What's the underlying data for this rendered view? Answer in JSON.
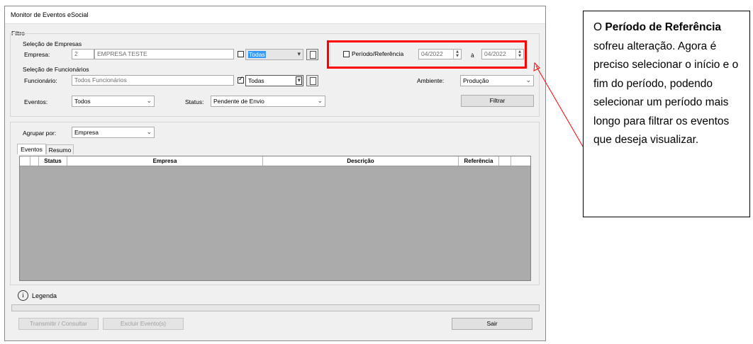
{
  "window": {
    "title": "Monitor de Eventos eSocial"
  },
  "filtro": {
    "group_label": "Filtro",
    "empresas": {
      "section_label": "Seleção de Empresas",
      "empresa_label": "Empresa:",
      "empresa_code": "2",
      "empresa_name": "EMPRESA TESTE",
      "todas_checked": false,
      "todas_value": "Todas"
    },
    "funcionarios": {
      "section_label": "Seleção de Funcionários",
      "funcionario_label": "Funcionário:",
      "funcionario_value": "Todos Funcionários",
      "todas_checked": true,
      "todas_value": "Todas"
    },
    "periodo": {
      "checkbox_label": "Período/Referência",
      "checked": false,
      "inicio": "04/2022",
      "separator": "à",
      "fim": "04/2022"
    },
    "ambiente": {
      "label": "Ambiente:",
      "value": "Produção"
    },
    "eventos": {
      "label": "Eventos:",
      "value": "Todos"
    },
    "status": {
      "label": "Status:",
      "value": "Pendente de Envio"
    },
    "filtrar_button": "Filtrar"
  },
  "agrupar": {
    "label": "Agrupar por:",
    "value": "Empresa"
  },
  "tabs": [
    {
      "label": "Eventos",
      "active": true
    },
    {
      "label": "Resumo",
      "active": false
    }
  ],
  "grid": {
    "columns": [
      "Status",
      "Empresa",
      "Descrição",
      "Referência"
    ],
    "rows": []
  },
  "legenda": {
    "icon": "info-icon",
    "label": "Legenda"
  },
  "footer": {
    "transmitir_button": "Transmitir / Consultar",
    "excluir_button": "Excluir Evento(s)",
    "sair_button": "Sair"
  },
  "annotation": {
    "p1": "O ",
    "bold": "Período de Referência",
    "p2": " sofreu alteração. Agora é preciso selecionar o início e o fim do período, podendo selecionar um período mais longo para filtrar os eventos que deseja visualizar."
  },
  "colors": {
    "highlight_border": "#ff0000",
    "selected_text_bg": "#3399ff"
  }
}
